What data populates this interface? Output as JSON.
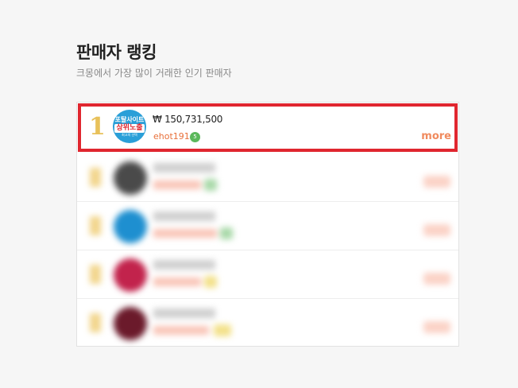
{
  "header": {
    "title": "판매자 랭킹",
    "subtitle": "크몽에서 가장 많이 거래한 인기 판매자"
  },
  "ranking": {
    "top": {
      "rank": "1",
      "price": "₩ 150,731,500",
      "seller": "ehot191",
      "level": "5",
      "more_label": "more",
      "avatar_text": [
        "포탈사이트",
        "상위노출",
        "최고의 선택"
      ]
    },
    "blurred_rows": [
      {
        "avatar_color": "#4a4a4a",
        "badge_color": "#a8d9a8"
      },
      {
        "avatar_color": "#1e8fd0",
        "badge_color": "#a8d9a8"
      },
      {
        "avatar_color": "#c2234c",
        "badge_color": "#f3e18a"
      },
      {
        "avatar_color": "#6b1a2b",
        "badge_color": "#f3e18a"
      }
    ],
    "colors": {
      "highlight_border": "#e0262f",
      "rank_gold": "#e8c15a",
      "seller_orange": "#e8703a",
      "more_orange": "#f08a5d",
      "level_green": "#5bb85b"
    }
  }
}
